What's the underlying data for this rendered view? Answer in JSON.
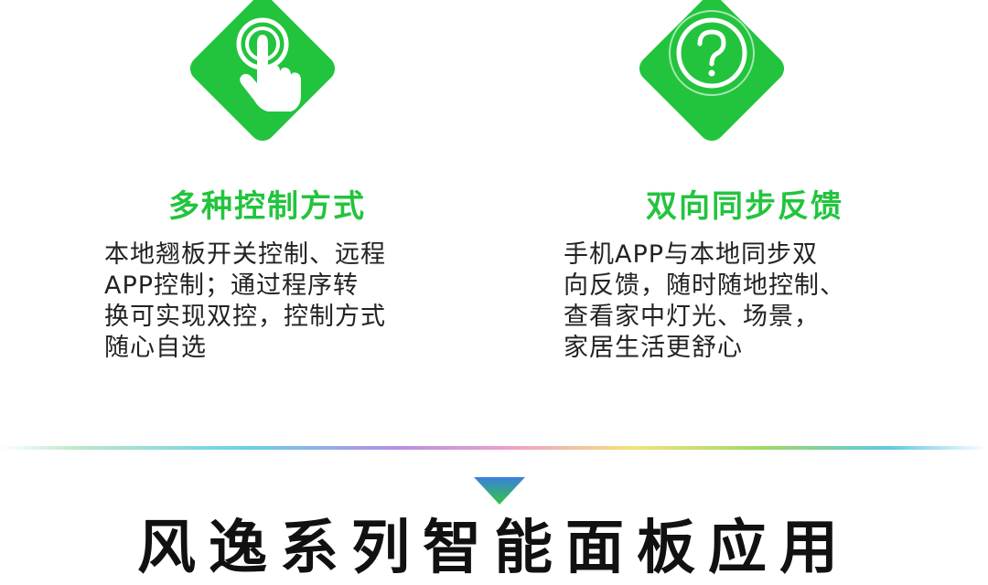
{
  "features": [
    {
      "icon": "tap-hand-icon",
      "title": "多种控制方式",
      "description": [
        "本地翘板开关控制、远程",
        "APP控制；通过程序转",
        "换可实现双控，控制方式",
        "随心自选"
      ]
    },
    {
      "icon": "question-circle-icon",
      "title": "双向同步反馈",
      "description": [
        "手机APP与本地同步双",
        "向反馈，随时随地控制、",
        "查看家中灯光、场景，",
        "家居生活更舒心"
      ]
    }
  ],
  "section": {
    "heading": "风逸系列智能面板应用",
    "arrow_icon": "triangle-down-icon"
  },
  "colors": {
    "brand_green": "#22c43d",
    "arrow_top": "#3b7fe0",
    "arrow_bottom": "#33c63e",
    "text": "#222222"
  }
}
